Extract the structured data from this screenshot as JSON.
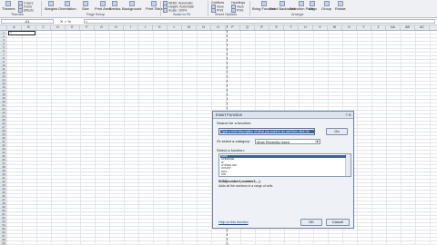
{
  "ribbon": {
    "items": [
      {
        "label": "Themes",
        "icon": "themes-icon"
      },
      {
        "label": "Margins",
        "icon": "margins-icon"
      },
      {
        "label": "Orientation",
        "icon": "orientation-icon"
      },
      {
        "label": "Size",
        "icon": "size-icon"
      },
      {
        "label": "Print Area",
        "icon": "print-area-icon"
      },
      {
        "label": "Breaks",
        "icon": "breaks-icon"
      },
      {
        "label": "Background",
        "icon": "background-icon"
      },
      {
        "label": "Print Titles",
        "icon": "print-titles-icon"
      },
      {
        "label": "Bring Forward",
        "icon": "bring-forward-icon"
      },
      {
        "label": "Send Backward",
        "icon": "send-backward-icon"
      },
      {
        "label": "Selection Pane",
        "icon": "selection-pane-icon"
      },
      {
        "label": "Align",
        "icon": "align-icon"
      },
      {
        "label": "Group",
        "icon": "group-icon"
      },
      {
        "label": "Rotate",
        "icon": "rotate-icon"
      }
    ],
    "small": {
      "colors": "Colors",
      "fonts": "Fonts",
      "effects": "Effects",
      "width": "Width:",
      "width_val": "Automatic",
      "height": "Height:",
      "height_val": "Automatic",
      "scale": "Scale:",
      "scale_val": "100%",
      "gridlines": "Gridlines",
      "headings": "Headings",
      "view1": "View",
      "print1": "Print",
      "view2": "View",
      "print2": "Print"
    },
    "groups": [
      "Themes",
      "Page Setup",
      "Scale to Fit",
      "Sheet Options",
      "Arrange"
    ]
  },
  "formula_bar": {
    "namebox": "A1",
    "buttons": "✕ ✓ fx",
    "value": "="
  },
  "columns": [
    "A",
    "B",
    "C",
    "D",
    "E",
    "F",
    "G",
    "H",
    "I",
    "J",
    "K",
    "L",
    "M",
    "N",
    "O",
    "P",
    "Q",
    "R",
    "S",
    "T",
    "U",
    "V",
    "W",
    "X",
    "Y",
    "Z",
    "AA",
    "AB",
    "AC"
  ],
  "rows": [
    "1",
    "2",
    "3",
    "4",
    "5",
    "6",
    "7",
    "8",
    "9",
    "10",
    "11",
    "12",
    "13",
    "14",
    "15",
    "16",
    "17",
    "18",
    "19",
    "20",
    "21",
    "22",
    "23",
    "24",
    "25",
    "26",
    "27",
    "28",
    "29",
    "30",
    "31",
    "32",
    "33",
    "34",
    "35",
    "36",
    "37",
    "38",
    "39",
    "40",
    "41",
    "42",
    "43",
    "44",
    "45",
    "46",
    "47",
    "48",
    "49",
    "50",
    "51",
    "52",
    "53",
    "54",
    "55",
    "56",
    "57",
    "58",
    "59"
  ],
  "active_cell": {
    "value": "="
  },
  "dialog": {
    "title": "Insert Function",
    "title_buttons": "? ✕",
    "search_label": "Search for a function:",
    "search_value": "Type a brief description of what you want to do and then click Go",
    "go_button": "Go",
    "category_label": "Or select a category:",
    "category_value": "Most Recently Used",
    "select_label": "Select a function:",
    "functions": [
      "SUM",
      "AVERAGE",
      "IF",
      "HYPERLINK",
      "COUNT",
      "MAX",
      "SIN"
    ],
    "selected_function": "SUM",
    "syntax": "SUM(number1,number2,...)",
    "description": "Adds all the numbers in a range of cells.",
    "help_link": "Help on this function",
    "ok_button": "OK",
    "cancel_button": "Cancel"
  }
}
